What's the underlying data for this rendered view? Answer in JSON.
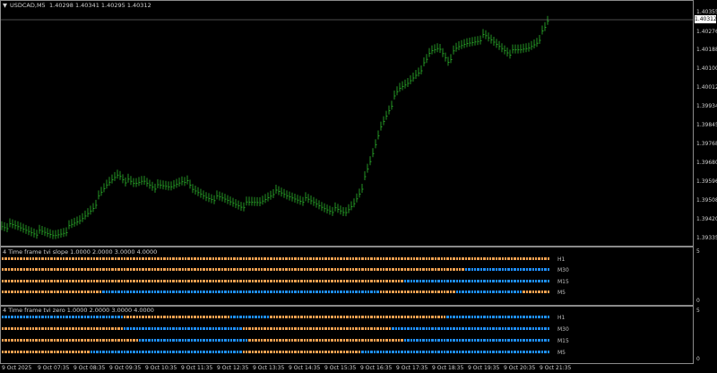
{
  "header": {
    "menu_icon": "triangle-down-icon",
    "symbol": "USDCAD,M5",
    "ohlc": "1.40298 1.40341 1.40295 1.40312"
  },
  "price_axis": [
    "1.40355",
    "1.40276",
    "1.40188",
    "1.40100",
    "1.40012",
    "1.39934",
    "1.39845",
    "1.39768",
    "1.39680",
    "1.39596",
    "1.39508",
    "1.39420",
    "1.39335"
  ],
  "current_price": "1.40312",
  "indicator1": {
    "title": "4 Time frame tvi slope 1.0000 2.0000 3.0000 4.0000",
    "scale_top": "5",
    "scale_bottom": "0",
    "rows": [
      {
        "label": "H1",
        "blue_from": 1.0,
        "blue_to": 1.0
      },
      {
        "label": "M30",
        "blue_from": 0.845,
        "blue_to": 1.0
      },
      {
        "label": "M15",
        "blue_from": 0.735,
        "blue_to": 1.0
      },
      {
        "label": "M5",
        "blue_from": 0.18,
        "blue_to": 0.69,
        "blue_from2": 0.83,
        "blue_to2": 0.95
      }
    ]
  },
  "indicator2": {
    "title": "4 Time frame tvi zero 1.0000 2.0000 3.0000 4.0000",
    "scale_top": "5",
    "scale_bottom": "0",
    "rows": [
      {
        "label": "H1",
        "segments": [
          [
            0,
            0.22,
            "blue"
          ],
          [
            0.22,
            0.415,
            "orange"
          ],
          [
            0.415,
            0.485,
            "blue"
          ],
          [
            0.485,
            0.81,
            "orange"
          ],
          [
            0.81,
            1,
            "blue"
          ]
        ]
      },
      {
        "label": "M30",
        "segments": [
          [
            0,
            0.22,
            "orange"
          ],
          [
            0.22,
            0.44,
            "blue"
          ],
          [
            0.44,
            0.71,
            "orange"
          ],
          [
            0.71,
            1,
            "blue"
          ]
        ]
      },
      {
        "label": "M15",
        "segments": [
          [
            0,
            0.25,
            "orange"
          ],
          [
            0.25,
            0.45,
            "blue"
          ],
          [
            0.45,
            0.735,
            "orange"
          ],
          [
            0.735,
            1,
            "blue"
          ]
        ]
      },
      {
        "label": "M5",
        "segments": [
          [
            0,
            0.16,
            "orange"
          ],
          [
            0.16,
            0.44,
            "blue"
          ],
          [
            0.44,
            0.655,
            "orange"
          ],
          [
            0.655,
            1,
            "blue"
          ]
        ]
      }
    ]
  },
  "time_axis": [
    "9 Oct 2025",
    "9 Oct 07:35",
    "9 Oct 08:35",
    "9 Oct 09:35",
    "9 Oct 10:35",
    "9 Oct 11:35",
    "9 Oct 12:35",
    "9 Oct 13:35",
    "9 Oct 14:35",
    "9 Oct 15:35",
    "9 Oct 16:35",
    "9 Oct 17:35",
    "9 Oct 18:35",
    "9 Oct 19:35",
    "9 Oct 20:35",
    "9 Oct 21:35"
  ],
  "colors": {
    "bull": "#2db82d",
    "orange": "#f0a050",
    "blue": "#1e8fff",
    "grid": "#8a8a8a"
  }
}
